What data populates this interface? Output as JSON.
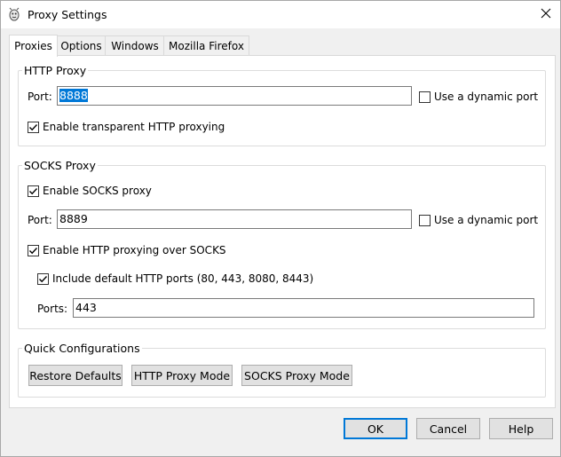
{
  "window": {
    "title": "Proxy Settings"
  },
  "tabs": [
    {
      "label": "Proxies",
      "active": true
    },
    {
      "label": "Options"
    },
    {
      "label": "Windows"
    },
    {
      "label": "Mozilla Firefox"
    }
  ],
  "http_proxy": {
    "legend": "HTTP Proxy",
    "port_label": "Port:",
    "port_value": "8888",
    "dynamic_port_label": "Use a dynamic port",
    "dynamic_port_checked": false,
    "transparent_label": "Enable transparent HTTP proxying",
    "transparent_checked": true
  },
  "socks_proxy": {
    "legend": "SOCKS Proxy",
    "enable_label": "Enable SOCKS proxy",
    "enable_checked": true,
    "port_label": "Port:",
    "port_value": "8889",
    "dynamic_port_label": "Use a dynamic port",
    "dynamic_port_checked": false,
    "http_over_socks_label": "Enable HTTP proxying over SOCKS",
    "http_over_socks_checked": true,
    "include_default_label": "Include default HTTP ports (80, 443, 8080, 8443)",
    "include_default_checked": true,
    "ports_label": "Ports:",
    "ports_value": "443"
  },
  "quick_config": {
    "legend": "Quick Configurations",
    "restore_defaults": "Restore Defaults",
    "http_proxy_mode": "HTTP Proxy Mode",
    "socks_proxy_mode": "SOCKS Proxy Mode"
  },
  "footer": {
    "ok": "OK",
    "cancel": "Cancel",
    "help": "Help"
  },
  "colors": {
    "accent": "#0078d7",
    "background": "#f0f0f0"
  }
}
